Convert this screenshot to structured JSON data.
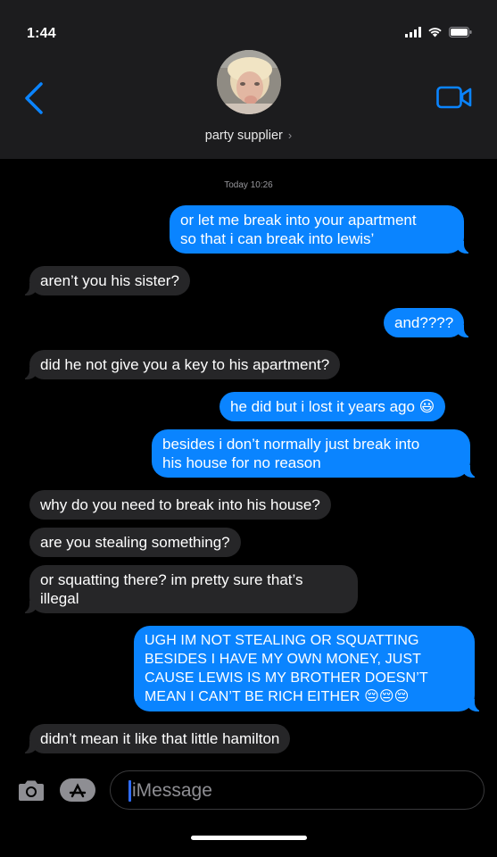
{
  "status_bar": {
    "time": "1:44"
  },
  "header": {
    "contact_name": "party supplier",
    "chevron": "›",
    "back_icon": "chevron-left-icon",
    "video_icon": "video-camera-icon"
  },
  "thread": {
    "timestamp": "Today 10:26",
    "messages": [
      {
        "dir": "out",
        "text": "or let me break into your apartment\nso that i can break into lewis’"
      },
      {
        "dir": "in",
        "text": "aren’t you his sister?"
      },
      {
        "dir": "out",
        "text": "and????"
      },
      {
        "dir": "in",
        "text": "did he not give you a key to his apartment?"
      },
      {
        "dir": "out",
        "text": "he did but i lost it years ago 😃"
      },
      {
        "dir": "out",
        "text": "besides i don’t normally just break into\nhis house for no reason"
      },
      {
        "dir": "in",
        "text": "why do you need to break into his house?"
      },
      {
        "dir": "in",
        "text": "are you stealing something?"
      },
      {
        "dir": "in",
        "text": "or squatting there? im pretty sure that’s\nillegal"
      },
      {
        "dir": "out",
        "text": "UGH IM NOT STEALING OR SQUATTING\nBESIDES I HAVE MY OWN MONEY, JUST\nCAUSE LEWIS IS MY BROTHER DOESN’T\nMEAN I CAN’T BE RICH EITHER 😔😔😔"
      },
      {
        "dir": "in",
        "text": "didn’t mean it like that little hamilton"
      }
    ]
  },
  "compose": {
    "placeholder": "iMessage",
    "camera_icon": "camera-icon",
    "apps_icon": "app-store-icon"
  },
  "colors": {
    "outgoing": "#0a84ff",
    "incoming": "#262628",
    "accent": "#0a84ff",
    "header_bg": "#1c1c1e"
  }
}
